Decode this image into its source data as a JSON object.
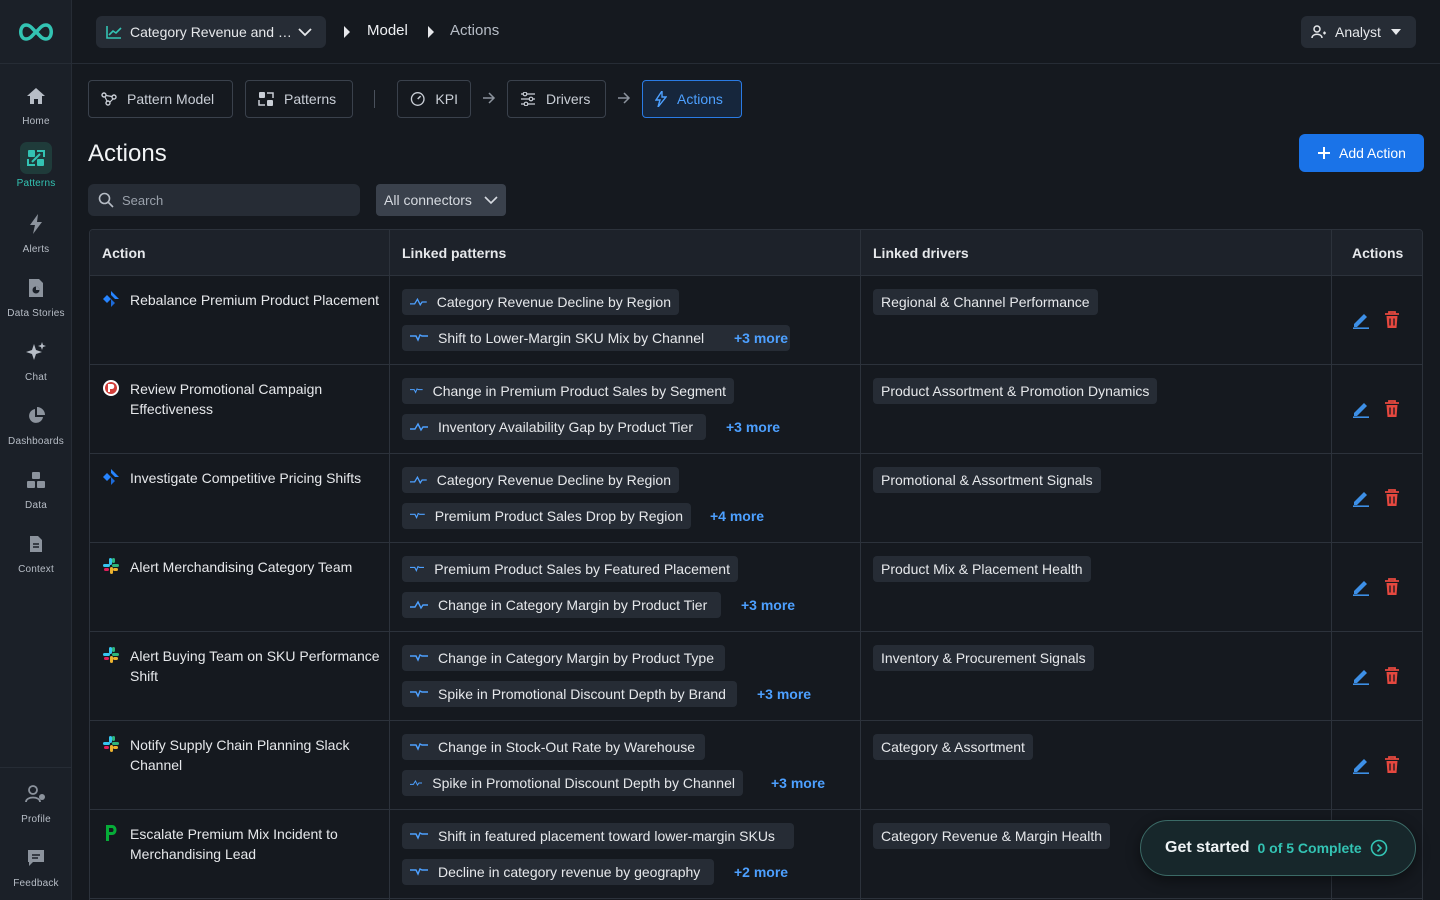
{
  "header": {
    "model_select": "Category Revenue and Premium Mix Model",
    "breadcrumb": [
      "Model",
      "Actions"
    ],
    "user": "Analyst"
  },
  "sidebar": {
    "items": [
      {
        "label": "Home",
        "icon": "home-icon"
      },
      {
        "label": "Patterns",
        "icon": "patterns-icon",
        "active": true
      },
      {
        "label": "Alerts",
        "icon": "bolt-icon"
      },
      {
        "label": "Data Stories",
        "icon": "data-stories-icon"
      },
      {
        "label": "Chat",
        "icon": "sparkle-icon"
      },
      {
        "label": "Dashboards",
        "icon": "pie-icon"
      },
      {
        "label": "Data",
        "icon": "data-icon"
      },
      {
        "label": "Context",
        "icon": "document-icon"
      }
    ],
    "bottom": [
      {
        "label": "Profile",
        "icon": "profile-icon"
      },
      {
        "label": "Feedback",
        "icon": "feedback-icon"
      }
    ]
  },
  "tabs": {
    "pattern_model": "Pattern Model",
    "patterns": "Patterns",
    "kpi": "KPI",
    "drivers": "Drivers",
    "actions": "Actions"
  },
  "page": {
    "title": "Actions",
    "add_button": "Add Action",
    "search_placeholder": "Search",
    "connector_filter": "All connectors"
  },
  "table": {
    "columns": [
      "Action",
      "Linked patterns",
      "Linked drivers",
      "Actions"
    ],
    "rows": [
      {
        "action": "Rebalance Premium Product Placement",
        "connector": "jira",
        "patterns": [
          "Category Revenue Decline by Region",
          "Shift to Lower-Margin SKU Mix by Channel"
        ],
        "more": "+3 more",
        "driver": "Regional & Channel Performance"
      },
      {
        "action": "Review Promotional Campaign Effectiveness",
        "connector": "pagerduty",
        "patterns": [
          "Change in Premium Product Sales by Segment",
          "Inventory Availability Gap by Product Tier"
        ],
        "more": "+3 more",
        "driver": "Product Assortment & Promotion Dynamics"
      },
      {
        "action": "Investigate Competitive Pricing Shifts",
        "connector": "jira",
        "patterns": [
          "Category Revenue Decline by Region",
          "Premium Product Sales Drop by Region"
        ],
        "more": "+4 more",
        "driver": "Promotional & Assortment Signals"
      },
      {
        "action": "Alert Merchandising Category Team",
        "connector": "slack",
        "patterns": [
          "Premium Product Sales by Featured Placement",
          "Change in Category Margin by Product Tier"
        ],
        "more": "+3 more",
        "driver": "Product Mix & Placement Health"
      },
      {
        "action": "Alert Buying Team on SKU Performance Shift",
        "connector": "slack",
        "patterns": [
          "Change in Category Margin by Product Type",
          "Spike in Promotional Discount Depth by Brand"
        ],
        "more": "+3 more",
        "driver": "Inventory & Procurement Signals"
      },
      {
        "action": "Notify Supply Chain Planning Slack Channel",
        "connector": "slack",
        "patterns": [
          "Change in Stock-Out Rate by Warehouse",
          "Spike in Promotional Discount Depth by Channel"
        ],
        "more": "+3 more",
        "driver": "Category & Assortment"
      },
      {
        "action": "Escalate Premium Mix Incident to Merchandising Lead",
        "connector": "pagerduty-p",
        "patterns": [
          "Shift in featured placement toward lower-margin SKUs",
          "Decline in category revenue by geography"
        ],
        "more": "+2 more",
        "driver": "Category Revenue & Margin Health"
      }
    ]
  },
  "get_started": {
    "title": "Get started",
    "progress": "0 of 5 Complete"
  },
  "colors": {
    "accent_teal": "#33c3b3",
    "accent_blue": "#1a73e8",
    "link_blue": "#4da0ff",
    "delete_red": "#e5483f"
  }
}
